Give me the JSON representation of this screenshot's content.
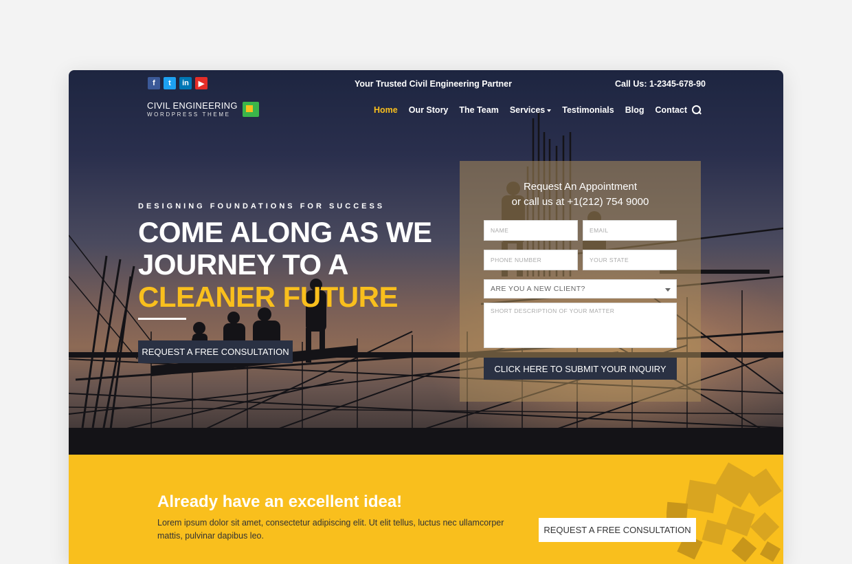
{
  "topbar": {
    "social": [
      "f",
      "t",
      "in",
      "▶"
    ],
    "tagline": "Your Trusted Civil Engineering Partner",
    "phone": "Call Us: 1-2345-678-90"
  },
  "logo": {
    "title": "CIVIL ENGINEERING",
    "subtitle": "WORDPRESS THEME"
  },
  "nav": {
    "items": [
      {
        "label": "Home"
      },
      {
        "label": "Our Story"
      },
      {
        "label": "The Team"
      },
      {
        "label": "Services"
      },
      {
        "label": "Testimonials"
      },
      {
        "label": "Blog"
      },
      {
        "label": "Contact"
      }
    ]
  },
  "hero": {
    "eyebrow": "DESIGNING FOUNDATIONS FOR SUCCESS",
    "headline_line1": "COME ALONG AS WE",
    "headline_line2": "JOURNEY TO A",
    "headline_highlight": "CLEANER FUTURE",
    "cta": "REQUEST A FREE CONSULTATION"
  },
  "form": {
    "title_line1": "Request An Appointment",
    "title_line2": "or call us at +1(212) 754 9000",
    "name_placeholder": "NAME",
    "email_placeholder": "EMAIL",
    "phone_placeholder": "PHONE NUMBER",
    "state_placeholder": "YOUR STATE",
    "client_select": "ARE YOU A NEW CLIENT?",
    "matter_placeholder": "SHORT DESCRIPTION OF YOUR MATTER",
    "submit": "CLICK HERE TO SUBMIT YOUR INQUIRY"
  },
  "band": {
    "title": "Already have an excellent idea!",
    "text": "Lorem ipsum dolor sit amet, consectetur adipiscing elit. Ut elit tellus, luctus nec ullamcorper mattis, pulvinar dapibus leo.",
    "cta": "REQUEST A FREE CONSULTATION"
  },
  "colors": {
    "accent": "#f9bf1d",
    "dark_button": "#2a3143"
  }
}
